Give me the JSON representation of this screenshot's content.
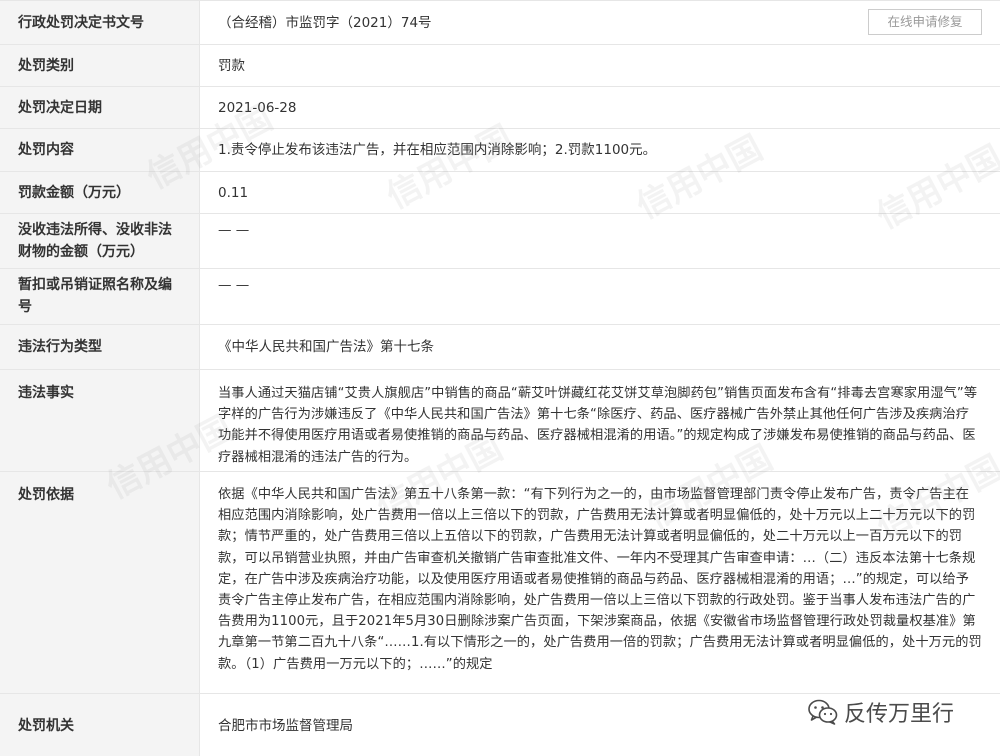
{
  "rows": [
    {
      "label": "行政处罚决定书文号",
      "value": "（合经稽）市监罚字（2021）74号"
    },
    {
      "label": "处罚类别",
      "value": "罚款"
    },
    {
      "label": "处罚决定日期",
      "value": "2021-06-28"
    },
    {
      "label": "处罚内容",
      "value": "1.责令停止发布该违法广告，并在相应范围内消除影响；2.罚款1100元。"
    },
    {
      "label": "罚款金额（万元）",
      "value": "0.11"
    },
    {
      "label": "没收违法所得、没收非法财物的金额（万元）",
      "value": "— —"
    },
    {
      "label": "暂扣或吊销证照名称及编号",
      "value": "— —"
    },
    {
      "label": "违法行为类型",
      "value": "《中华人民共和国广告法》第十七条"
    },
    {
      "label": "违法事实",
      "value": "当事人通过天猫店铺“艾贵人旗舰店”中销售的商品“蕲艾叶饼藏红花艾饼艾草泡脚药包”销售页面发布含有“排毒去宫寒家用湿气”等字样的广告行为涉嫌违反了《中华人民共和国广告法》第十七条“除医疗、药品、医疗器械广告外禁止其他任何广告涉及疾病治疗功能并不得使用医疗用语或者易使推销的商品与药品、医疗器械相混淆的用语。”的规定构成了涉嫌发布易使推销的商品与药品、医疗器械相混淆的违法广告的行为。"
    },
    {
      "label": "处罚依据",
      "value": "依据《中华人民共和国广告法》第五十八条第一款：“有下列行为之一的，由市场监督管理部门责令停止发布广告，责令广告主在相应范围内消除影响，处广告费用一倍以上三倍以下的罚款，广告费用无法计算或者明显偏低的，处十万元以上二十万元以下的罚款；情节严重的，处广告费用三倍以上五倍以下的罚款，广告费用无法计算或者明显偏低的，处二十万元以上一百万元以下的罚款，可以吊销营业执照，并由广告审查机关撤销广告审查批准文件、一年内不受理其广告审查申请：…（二）违反本法第十七条规定，在广告中涉及疾病治疗功能，以及使用医疗用语或者易使推销的商品与药品、医疗器械相混淆的用语；…”的规定，可以给予责令广告主停止发布广告，在相应范围内消除影响，处广告费用一倍以上三倍以下罚款的行政处罚。鉴于当事人发布违法广告的广告费用为1100元，且于2021年5月30日删除涉案广告页面，下架涉案商品，依据《安徽省市场监督管理行政处罚裁量权基准》第九章第一节第二百九十八条“……1.有以下情形之一的，处广告费用一倍的罚款；广告费用无法计算或者明显偏低的，处十万元的罚款。（1）广告费用一万元以下的；……”的规定"
    },
    {
      "label": "处罚机关",
      "value": "合肥市市场监督管理局"
    }
  ],
  "repair_button": "在线申请修复",
  "watermark": "信用中国",
  "brand": {
    "text": "反传万里行",
    "icon": "wechat-icon"
  }
}
